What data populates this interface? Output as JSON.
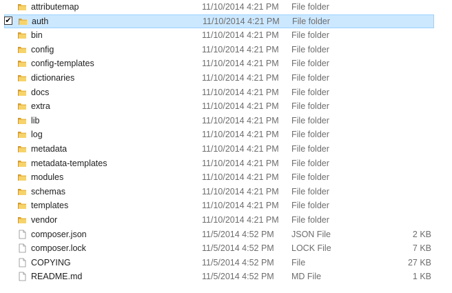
{
  "files": [
    {
      "name": "attributemap",
      "date": "11/10/2014 4:21 PM",
      "type": "File folder",
      "size": "",
      "kind": "folder",
      "selected": false
    },
    {
      "name": "auth",
      "date": "11/10/2014 4:21 PM",
      "type": "File folder",
      "size": "",
      "kind": "folder",
      "selected": true
    },
    {
      "name": "bin",
      "date": "11/10/2014 4:21 PM",
      "type": "File folder",
      "size": "",
      "kind": "folder",
      "selected": false
    },
    {
      "name": "config",
      "date": "11/10/2014 4:21 PM",
      "type": "File folder",
      "size": "",
      "kind": "folder",
      "selected": false
    },
    {
      "name": "config-templates",
      "date": "11/10/2014 4:21 PM",
      "type": "File folder",
      "size": "",
      "kind": "folder",
      "selected": false
    },
    {
      "name": "dictionaries",
      "date": "11/10/2014 4:21 PM",
      "type": "File folder",
      "size": "",
      "kind": "folder",
      "selected": false
    },
    {
      "name": "docs",
      "date": "11/10/2014 4:21 PM",
      "type": "File folder",
      "size": "",
      "kind": "folder",
      "selected": false
    },
    {
      "name": "extra",
      "date": "11/10/2014 4:21 PM",
      "type": "File folder",
      "size": "",
      "kind": "folder",
      "selected": false
    },
    {
      "name": "lib",
      "date": "11/10/2014 4:21 PM",
      "type": "File folder",
      "size": "",
      "kind": "folder",
      "selected": false
    },
    {
      "name": "log",
      "date": "11/10/2014 4:21 PM",
      "type": "File folder",
      "size": "",
      "kind": "folder",
      "selected": false
    },
    {
      "name": "metadata",
      "date": "11/10/2014 4:21 PM",
      "type": "File folder",
      "size": "",
      "kind": "folder",
      "selected": false
    },
    {
      "name": "metadata-templates",
      "date": "11/10/2014 4:21 PM",
      "type": "File folder",
      "size": "",
      "kind": "folder",
      "selected": false
    },
    {
      "name": "modules",
      "date": "11/10/2014 4:21 PM",
      "type": "File folder",
      "size": "",
      "kind": "folder",
      "selected": false
    },
    {
      "name": "schemas",
      "date": "11/10/2014 4:21 PM",
      "type": "File folder",
      "size": "",
      "kind": "folder",
      "selected": false
    },
    {
      "name": "templates",
      "date": "11/10/2014 4:21 PM",
      "type": "File folder",
      "size": "",
      "kind": "folder",
      "selected": false
    },
    {
      "name": "vendor",
      "date": "11/10/2014 4:21 PM",
      "type": "File folder",
      "size": "",
      "kind": "folder",
      "selected": false
    },
    {
      "name": "composer.json",
      "date": "11/5/2014 4:52 PM",
      "type": "JSON File",
      "size": "2 KB",
      "kind": "file",
      "selected": false
    },
    {
      "name": "composer.lock",
      "date": "11/5/2014 4:52 PM",
      "type": "LOCK File",
      "size": "7 KB",
      "kind": "file",
      "selected": false
    },
    {
      "name": "COPYING",
      "date": "11/5/2014 4:52 PM",
      "type": "File",
      "size": "27 KB",
      "kind": "file",
      "selected": false
    },
    {
      "name": "README.md",
      "date": "11/5/2014 4:52 PM",
      "type": "MD File",
      "size": "1 KB",
      "kind": "file",
      "selected": false
    }
  ],
  "colors": {
    "folder_body": "#e8b84a",
    "folder_front": "#f6d36b",
    "selection_bg": "#cce8ff",
    "selection_border": "#99d1ff",
    "secondary_text": "#6d6d6d"
  },
  "icons": {
    "folder": "folder-icon",
    "file": "file-icon",
    "check": "checkbox-checked-icon"
  }
}
